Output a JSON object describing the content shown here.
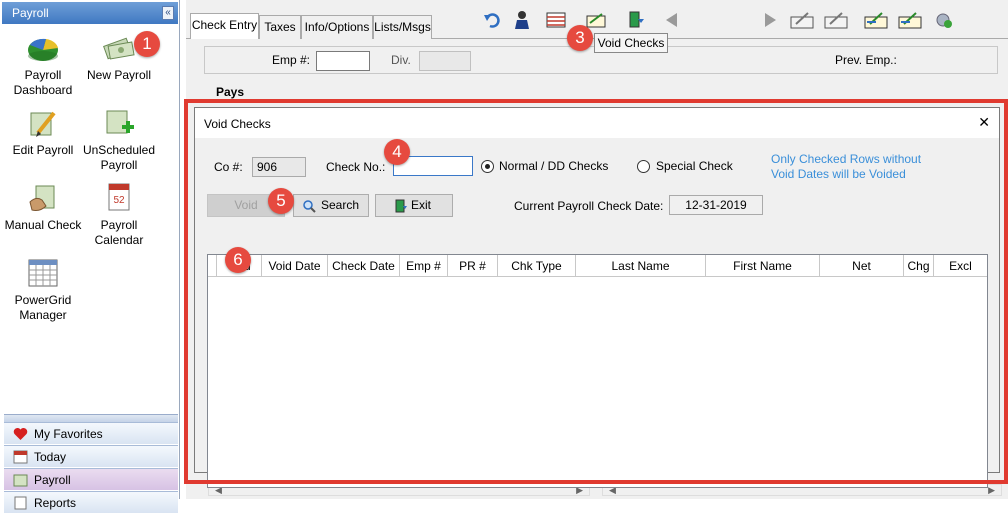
{
  "sidebar": {
    "title": "Payroll",
    "collapse_glyph": "«",
    "tiles": [
      {
        "label": "Payroll Dashboard",
        "icon": "dashboard-chart-icon"
      },
      {
        "label": "New Payroll",
        "icon": "money-stack-icon"
      },
      {
        "label": "Edit Payroll",
        "icon": "edit-money-icon"
      },
      {
        "label": "UnScheduled Payroll",
        "icon": "unscheduled-money-icon"
      },
      {
        "label": "Manual Check",
        "icon": "hand-check-icon"
      },
      {
        "label": "Payroll Calendar",
        "icon": "calendar-icon"
      },
      {
        "label": "PowerGrid Manager",
        "icon": "grid-icon"
      }
    ],
    "calendar_day": "52",
    "nav": [
      {
        "label": "My Favorites",
        "icon": "heart-icon"
      },
      {
        "label": "Today",
        "icon": "today-calendar-icon"
      },
      {
        "label": "Payroll",
        "icon": "payroll-icon"
      },
      {
        "label": "Reports",
        "icon": "reports-icon"
      }
    ]
  },
  "tabs": [
    "Check Entry",
    "Taxes",
    "Info/Options",
    "Lists/Msgs"
  ],
  "toolbar": {
    "tooltip": "Void Checks",
    "icons": [
      "undo-icon",
      "employee-icon",
      "grid-lines-icon",
      "void-checks-icon",
      "exit-door-icon",
      "prev-triangle-icon",
      "next-triangle-icon",
      "check-edit-icon",
      "check-write-icon",
      "check-approve-icon",
      "check-finalize-icon",
      "settings-check-icon"
    ]
  },
  "form": {
    "emp_label": "Emp #:",
    "emp_value": "",
    "div_label": "Div.",
    "div_value": "",
    "prev_emp_label": "Prev. Emp.:",
    "pays_label": "Pays"
  },
  "dialog": {
    "title": "Void Checks",
    "close_glyph": "✕",
    "co_label": "Co #:",
    "co_value": "906",
    "check_no_label": "Check No.:",
    "check_no_value": "",
    "radio_normal": "Normal / DD Checks",
    "radio_special": "Special Check",
    "radio_selected": "normal",
    "note": "Only Checked Rows without Void Dates will be Voided",
    "void_button": "Void",
    "search_button": "Search",
    "exit_button": "Exit",
    "current_date_label": "Current Payroll Check Date:",
    "current_date_value": "12-31-2019",
    "columns": [
      "Void",
      "Void Date",
      "Check Date",
      "Emp #",
      "PR #",
      "Chk Type",
      "Last Name",
      "First Name",
      "Net",
      "Chg",
      "Excl"
    ],
    "rows": []
  },
  "callouts": [
    "1",
    "3",
    "4",
    "5",
    "6"
  ],
  "colors": {
    "callout": "#e64a3f",
    "highlight_frame": "#e03a30",
    "note_text": "#3a8fd9",
    "sidebar_header": "#3f78c2"
  }
}
